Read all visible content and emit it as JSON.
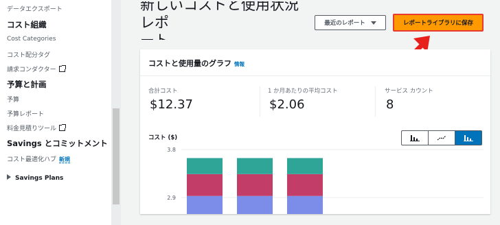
{
  "sidebar": {
    "items": [
      {
        "label": "データエクスポート",
        "kind": "item"
      },
      {
        "label": "コスト組織",
        "kind": "head"
      },
      {
        "label": "Cost Categories",
        "kind": "item"
      },
      {
        "label": "コスト配分タグ",
        "kind": "item"
      },
      {
        "label": "請求コンダクター",
        "kind": "item",
        "external": true
      },
      {
        "label": "予算と計画",
        "kind": "head"
      },
      {
        "label": "予算",
        "kind": "item"
      },
      {
        "label": "予算レポート",
        "kind": "item"
      },
      {
        "label": "料金見積りツール",
        "kind": "item",
        "external": true
      },
      {
        "label": "Savings とコミットメント",
        "kind": "head"
      },
      {
        "label": "コスト最適化ハブ",
        "kind": "item",
        "badge": "新規"
      },
      {
        "label": "Savings Plans",
        "kind": "expander"
      }
    ]
  },
  "header": {
    "title_line1": "新しいコストと使用状況レポ",
    "title_line2": "ート",
    "recent_reports_label": "最近のレポート",
    "save_label": "レポートライブラリに保存"
  },
  "card": {
    "title": "コストと使用量のグラフ",
    "info_label": "情報",
    "metrics": [
      {
        "label": "合計コスト",
        "value": "$12.37"
      },
      {
        "label": "1 か月あたりの平均コスト",
        "value": "$2.06"
      },
      {
        "label": "サービス カウント",
        "value": "8"
      }
    ]
  },
  "chart_data": {
    "type": "bar",
    "ylabel": "コスト ($)",
    "y_ticks": [
      "3.8",
      "2.9"
    ],
    "ylim": [
      2.9,
      3.8
    ],
    "categories": [
      "",
      "",
      ""
    ],
    "series": [
      {
        "color": "#7b8de8",
        "values": [
          2.93,
          2.93,
          2.93
        ]
      },
      {
        "color": "#c33d69",
        "values": [
          0.41,
          0.41,
          0.41
        ]
      },
      {
        "color": "#2ea597",
        "values": [
          0.3,
          0.3,
          0.3
        ]
      }
    ],
    "view_toggle": [
      {
        "icon": "bar-chart-icon",
        "active": false
      },
      {
        "icon": "line-chart-icon",
        "active": false
      },
      {
        "icon": "stacked-bar-icon",
        "active": true
      }
    ]
  },
  "colors": {
    "accent": "#ff9900",
    "link": "#0073bb",
    "highlight": "#e83a2f"
  }
}
